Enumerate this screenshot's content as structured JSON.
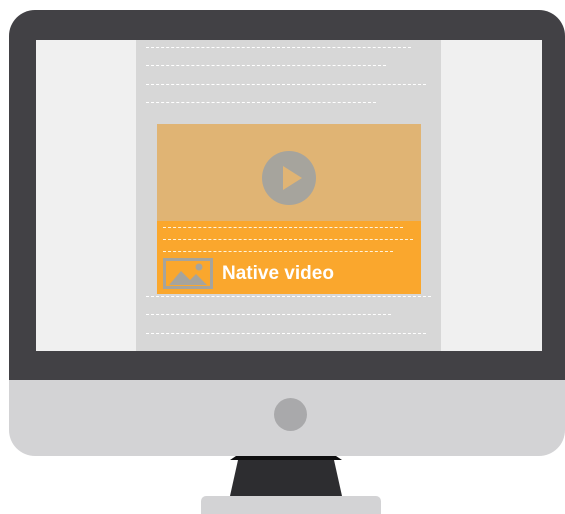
{
  "ad": {
    "label": "Native video"
  },
  "icons": {
    "play": "play-icon",
    "image": "image-icon"
  },
  "colors": {
    "bezel": "#424145",
    "chin": "#d3d3d5",
    "screen": "#f0f0f0",
    "column": "#d7d7d7",
    "video_area": "#e0b474",
    "ad_accent": "#faa72d"
  }
}
